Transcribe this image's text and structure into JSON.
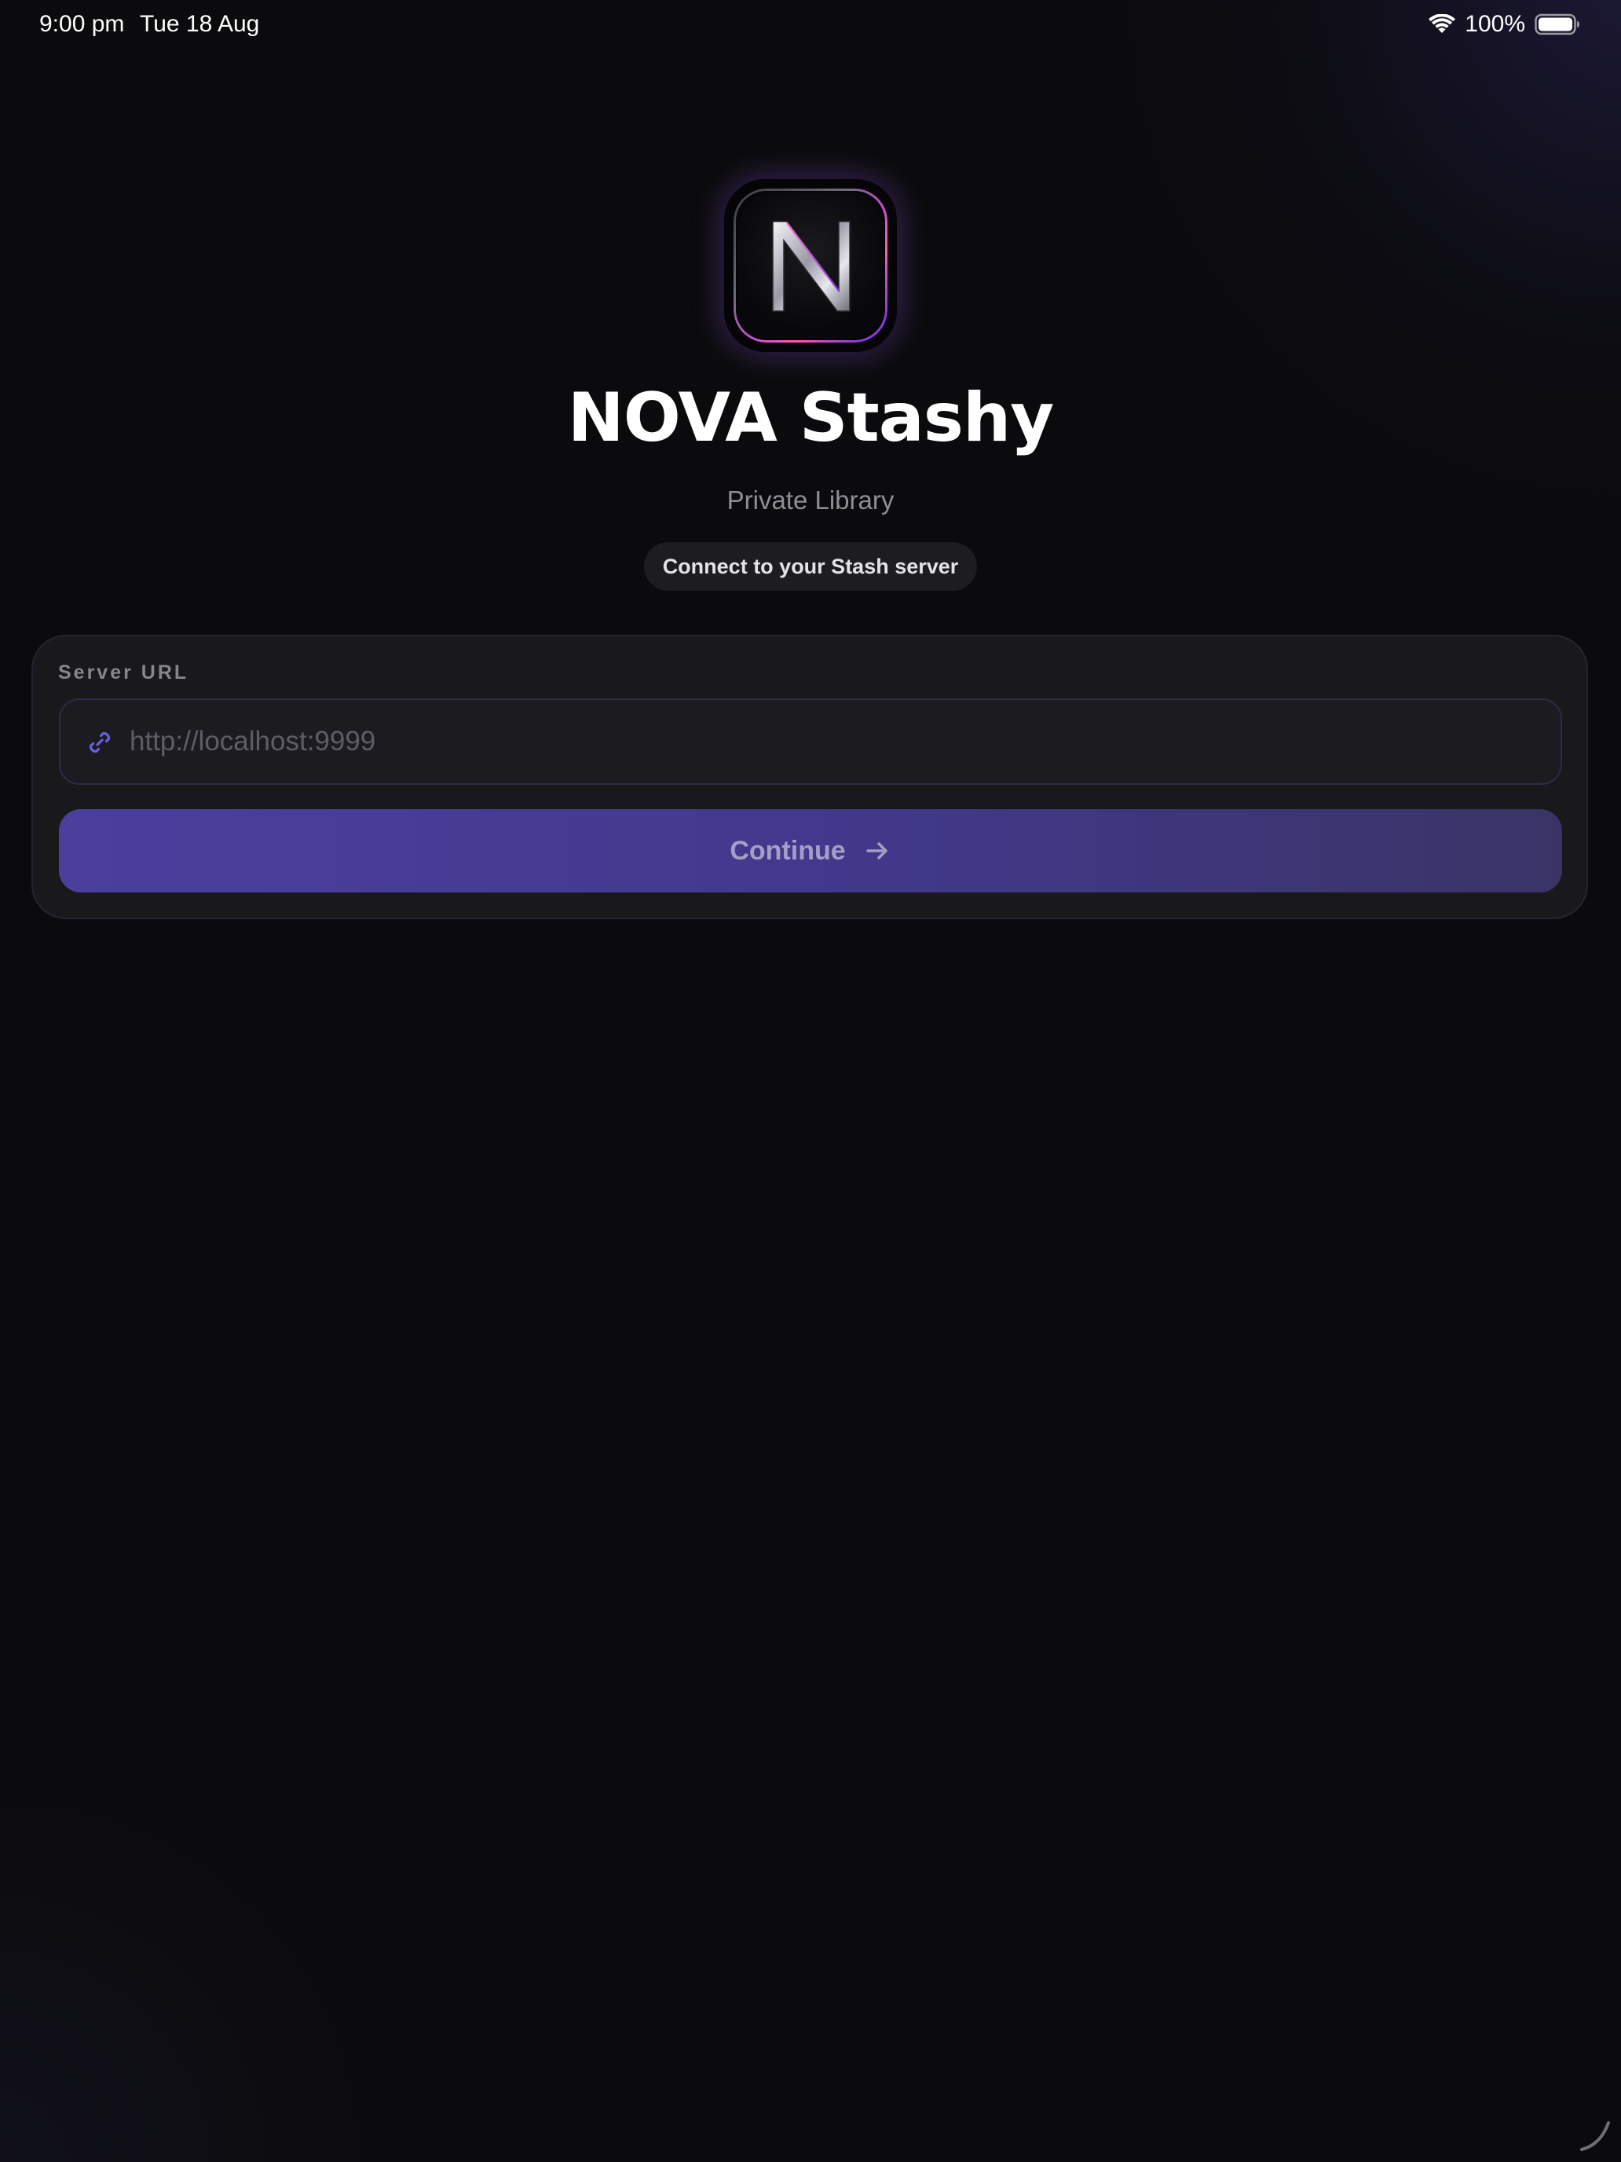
{
  "status_bar": {
    "time": "9:00 pm",
    "date": "Tue 18 Aug",
    "battery_percent": "100%",
    "icons": [
      "wifi-icon",
      "battery-icon"
    ]
  },
  "app": {
    "logo_letter": "N",
    "title": "NOVA Stashy",
    "subtitle": "Private Library",
    "tagline": "Connect to your Stash server"
  },
  "form": {
    "server_url_label": "Server URL",
    "server_url_placeholder": "http://localhost:9999",
    "server_url_value": "",
    "continue_label": "Continue",
    "icons": [
      "link-icon",
      "arrow-right-icon"
    ]
  },
  "colors": {
    "background": "#0b0b0d",
    "accent": "#4b3f9e",
    "accent_text": "#a49ec8",
    "link_icon": "#6b5ee0",
    "logo_glow": "#d04ad8"
  }
}
